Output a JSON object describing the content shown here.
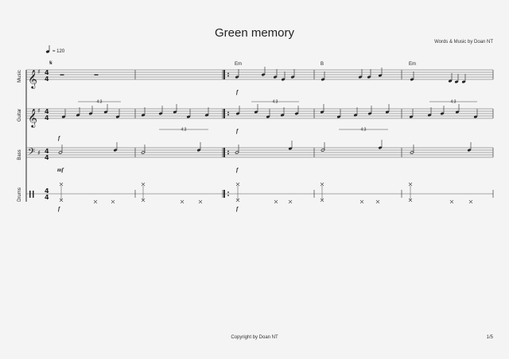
{
  "score": {
    "title": "Green memory",
    "credits": "Words & Music by Doan NT",
    "copyright": "Copyright by Doan NT",
    "page_number": "1/5",
    "tempo": "= 120",
    "tuplet_label": "4:3",
    "chords": [
      "Em",
      "B",
      "Em"
    ],
    "instruments": [
      {
        "name": "Music",
        "dynamic": "f"
      },
      {
        "name": "Guitar",
        "dynamic": "f"
      },
      {
        "name": "Bass",
        "dynamic": "mf",
        "dynamic_repeat": "f"
      },
      {
        "name": "Drums",
        "dynamic": "f"
      }
    ]
  }
}
